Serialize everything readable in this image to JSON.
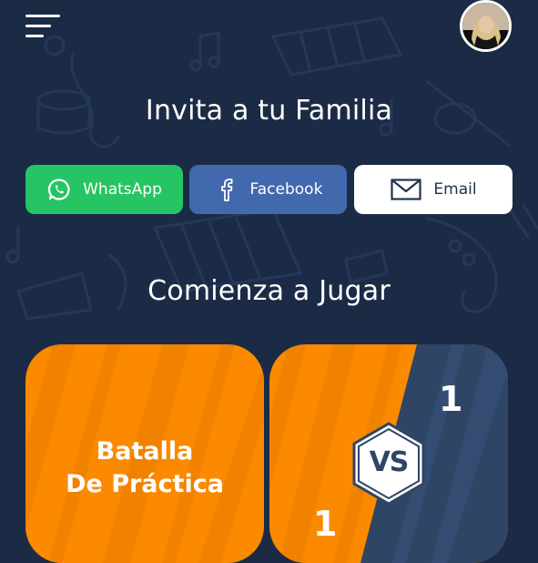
{
  "header": {
    "menu_icon": "hamburger-menu-icon",
    "avatar_icon": "user-avatar"
  },
  "invite": {
    "title": "Invita a tu Familia",
    "buttons": [
      {
        "label": "WhatsApp",
        "icon": "whatsapp-icon",
        "color": "#27c463"
      },
      {
        "label": "Facebook",
        "icon": "facebook-icon",
        "color": "#4269ae"
      },
      {
        "label": "Email",
        "icon": "envelope-icon",
        "color": "#ffffff"
      }
    ]
  },
  "play": {
    "title": "Comienza a Jugar",
    "practice_card": {
      "line1": "Batalla",
      "line2": "De Práctica",
      "color": "#fb8a00"
    },
    "versus_card": {
      "badge": "VS",
      "score_top": "1",
      "score_bottom": "1",
      "color_left": "#fb8a00",
      "color_right": "#2f4566"
    }
  },
  "colors": {
    "background": "#1c2b45",
    "accent_orange": "#fb8a00",
    "dark_blue": "#2f4566"
  }
}
